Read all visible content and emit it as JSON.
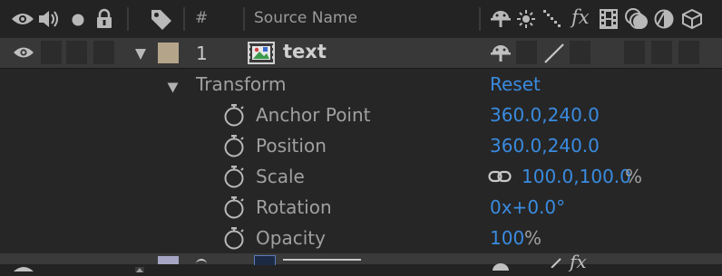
{
  "header": {
    "hash_label": "#",
    "source_name_label": "Source Name",
    "fx_label": "fx"
  },
  "layer": {
    "number": "1",
    "name": "text",
    "label_color": "#b4a58a"
  },
  "transform": {
    "label": "Transform",
    "reset_label": "Reset",
    "properties": [
      {
        "name": "Anchor Point",
        "value": "360.0,240.0",
        "unit": ""
      },
      {
        "name": "Position",
        "value": "360.0,240.0",
        "unit": ""
      },
      {
        "name": "Scale",
        "value": "100.0,100.0",
        "unit": "%"
      },
      {
        "name": "Rotation",
        "value": "0x+0.0°",
        "unit": ""
      },
      {
        "name": "Opacity",
        "value": "100",
        "unit": "%"
      }
    ]
  },
  "next_layer": {
    "fx_label": "fx"
  },
  "colors": {
    "accent_value": "#3a8be0",
    "next_label_color": "#a6a6c4"
  }
}
